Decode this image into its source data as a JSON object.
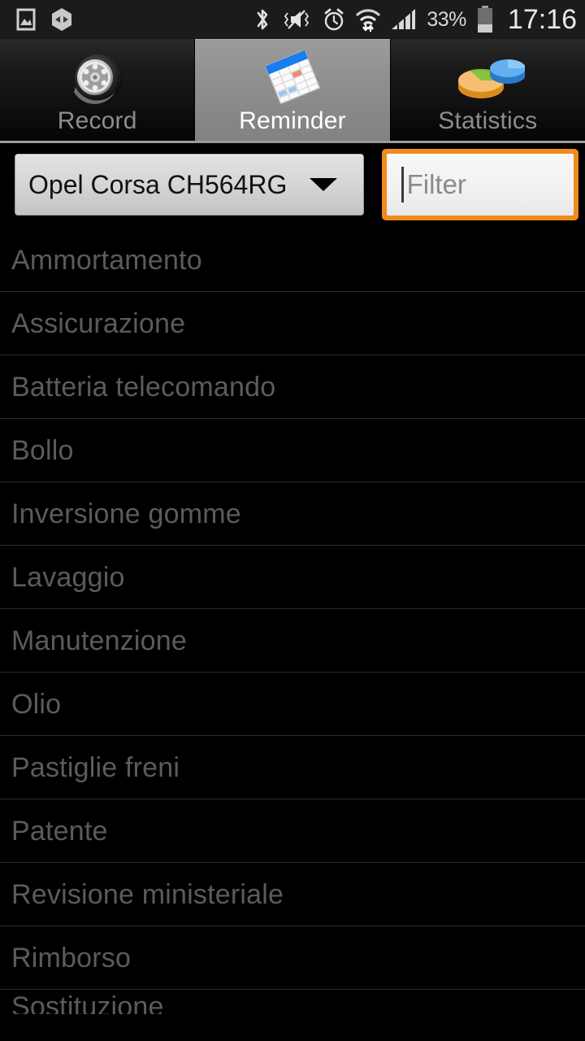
{
  "status_bar": {
    "left_icons": [
      {
        "name": "image-icon",
        "glyph": "image"
      },
      {
        "name": "hexagon-badge-icon",
        "glyph": "hexagon"
      }
    ],
    "right_icons": [
      {
        "name": "bluetooth-icon",
        "glyph": "bluetooth"
      },
      {
        "name": "vibrate-mute-icon",
        "glyph": "mute"
      },
      {
        "name": "alarm-clock-icon",
        "glyph": "alarm"
      },
      {
        "name": "wifi-data-icon",
        "glyph": "wifi"
      },
      {
        "name": "signal-bars-icon",
        "glyph": "signal"
      }
    ],
    "battery_percent": "33%",
    "clock": "17:16"
  },
  "tabs": [
    {
      "label": "Record",
      "icon": "tire-wheel-icon",
      "selected": false
    },
    {
      "label": "Reminder",
      "icon": "calendar-icon",
      "selected": true
    },
    {
      "label": "Statistics",
      "icon": "pie-chart-icon",
      "selected": false
    }
  ],
  "controls": {
    "vehicle_spinner": {
      "selected": "Opel Corsa CH564RG",
      "icon": "chevron-down-icon"
    },
    "filter_input": {
      "value": "",
      "placeholder": "Filter",
      "focused": true
    }
  },
  "reminder_list": {
    "items": [
      {
        "label": "Ammortamento"
      },
      {
        "label": "Assicurazione"
      },
      {
        "label": "Batteria telecomando"
      },
      {
        "label": "Bollo"
      },
      {
        "label": "Inversione gomme"
      },
      {
        "label": "Lavaggio"
      },
      {
        "label": "Manutenzione"
      },
      {
        "label": "Olio"
      },
      {
        "label": "Pastiglie freni"
      },
      {
        "label": "Patente"
      },
      {
        "label": "Revisione ministeriale"
      },
      {
        "label": "Rimborso"
      }
    ],
    "partial_item": {
      "label": "Sostituzione"
    }
  },
  "colors": {
    "accent_focus": "#f08a1e",
    "background": "#000000",
    "status_bar_bg": "#1b1b1b",
    "tab_selected_bg": "#8e8e8e",
    "list_text": "#5b5b5b",
    "separator": "#2c2c2c"
  }
}
